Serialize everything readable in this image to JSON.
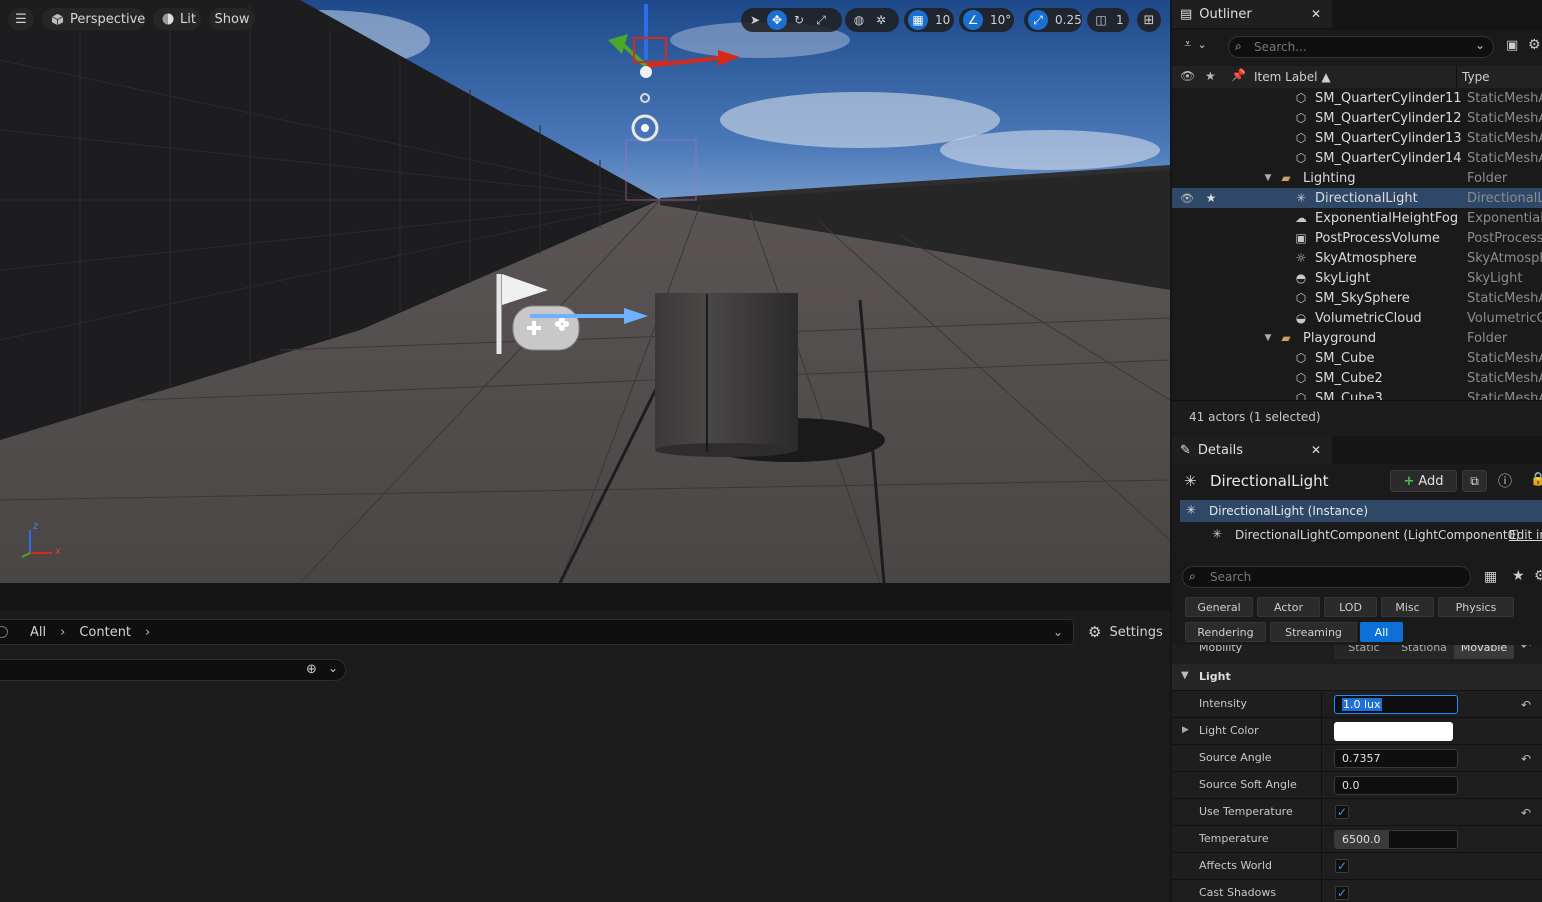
{
  "viewport": {
    "view_mode": "Perspective",
    "lighting_mode": "Lit",
    "show_label": "Show",
    "grid_snap": "10",
    "rotation_snap": "10°",
    "scale_snap": "0.25",
    "camera_speed": "1",
    "axis_labels": {
      "z": "z",
      "x": "x"
    }
  },
  "content_browser": {
    "breadcrumb": [
      "All",
      "Content"
    ],
    "settings_label": "Settings"
  },
  "outliner": {
    "title": "Outliner",
    "search_placeholder": "Search...",
    "col_label": "Item Label ▲",
    "col_type": "Type",
    "rows": [
      {
        "label": "SM_QuarterCylinder11",
        "type": "StaticMeshAc",
        "icon": "static-mesh-icon",
        "indent": 2
      },
      {
        "label": "SM_QuarterCylinder12",
        "type": "StaticMeshAc",
        "icon": "static-mesh-icon",
        "indent": 2
      },
      {
        "label": "SM_QuarterCylinder13",
        "type": "StaticMeshAc",
        "icon": "static-mesh-icon",
        "indent": 2
      },
      {
        "label": "SM_QuarterCylinder14",
        "type": "StaticMeshAc",
        "icon": "static-mesh-icon",
        "indent": 2
      },
      {
        "label": "Lighting",
        "type": "Folder",
        "icon": "folder-icon",
        "indent": 1,
        "folder": true
      },
      {
        "label": "DirectionalLight",
        "type": "DirectionalLig",
        "icon": "directional-light-icon",
        "indent": 2,
        "selected": true
      },
      {
        "label": "ExponentialHeightFog",
        "type": "ExponentialH",
        "icon": "fog-icon",
        "indent": 2
      },
      {
        "label": "PostProcessVolume",
        "type": "PostProcessV",
        "icon": "volume-icon",
        "indent": 2
      },
      {
        "label": "SkyAtmosphere",
        "type": "SkyAtmosphe",
        "icon": "sky-atmosphere-icon",
        "indent": 2
      },
      {
        "label": "SkyLight",
        "type": "SkyLight",
        "icon": "sky-light-icon",
        "indent": 2
      },
      {
        "label": "SM_SkySphere",
        "type": "StaticMeshAc",
        "icon": "static-mesh-icon",
        "indent": 2
      },
      {
        "label": "VolumetricCloud",
        "type": "VolumetricClo",
        "icon": "cloud-icon",
        "indent": 2
      },
      {
        "label": "Playground",
        "type": "Folder",
        "icon": "folder-icon",
        "indent": 1,
        "folder": true
      },
      {
        "label": "SM_Cube",
        "type": "StaticMeshAc",
        "icon": "static-mesh-icon",
        "indent": 2
      },
      {
        "label": "SM_Cube2",
        "type": "StaticMeshAc",
        "icon": "static-mesh-icon",
        "indent": 2
      },
      {
        "label": "SM_Cube3",
        "type": "StaticMeshAc",
        "icon": "static-mesh-icon",
        "indent": 2
      }
    ],
    "status": "41 actors (1 selected)"
  },
  "details": {
    "title": "Details",
    "actor_name": "DirectionalLight",
    "add_label": "Add",
    "instance_label": "DirectionalLight (Instance)",
    "component_label": "DirectionalLightComponent (LightComponent0)",
    "edit_link": "Edit in",
    "search_placeholder": "Search",
    "filters_row1": [
      "General",
      "Actor",
      "LOD",
      "Misc",
      "Physics"
    ],
    "filters_row2": [
      "Rendering",
      "Streaming",
      "All"
    ],
    "active_filter": "All",
    "mobility": {
      "label": "Mobility",
      "options": [
        "Static",
        "Stationa",
        "Movable"
      ],
      "selected": "Movable"
    },
    "section": "Light",
    "props": {
      "intensity": {
        "label": "Intensity",
        "value": "1.0 lux"
      },
      "light_color": {
        "label": "Light Color",
        "value": "#ffffff"
      },
      "source_angle": {
        "label": "Source Angle",
        "value": "0.7357"
      },
      "source_soft_angle": {
        "label": "Source Soft Angle",
        "value": "0.0"
      },
      "use_temperature": {
        "label": "Use Temperature",
        "checked": true
      },
      "temperature": {
        "label": "Temperature",
        "value": "6500.0"
      },
      "affects_world": {
        "label": "Affects World",
        "checked": true
      },
      "cast_shadows": {
        "label": "Cast Shadows",
        "checked": true
      }
    }
  },
  "colors": {
    "accent": "#0d70d6",
    "selection": "#2f4868"
  }
}
